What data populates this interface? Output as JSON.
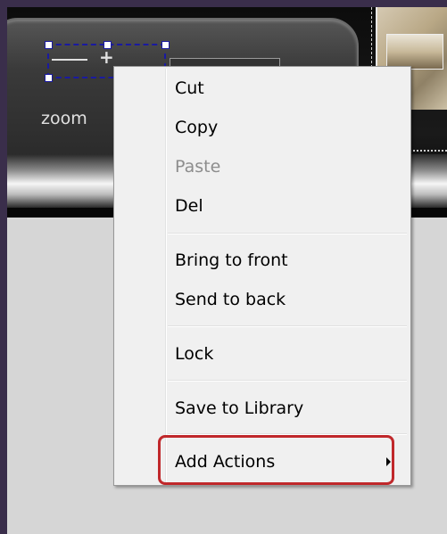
{
  "canvas": {
    "zoom_label": "zoom",
    "zoom_plus": "+"
  },
  "context_menu": {
    "items": [
      {
        "label": "Cut",
        "enabled": true
      },
      {
        "label": "Copy",
        "enabled": true
      },
      {
        "label": "Paste",
        "enabled": false
      },
      {
        "label": "Del",
        "enabled": true
      },
      {
        "label": "Bring to front",
        "enabled": true
      },
      {
        "label": "Send to back",
        "enabled": true
      },
      {
        "label": "Lock",
        "enabled": true
      },
      {
        "label": "Save to Library",
        "enabled": true
      },
      {
        "label": "Add Actions",
        "enabled": true,
        "has_submenu": true,
        "highlighted": true
      }
    ],
    "highlight_color": "#c0282b"
  }
}
